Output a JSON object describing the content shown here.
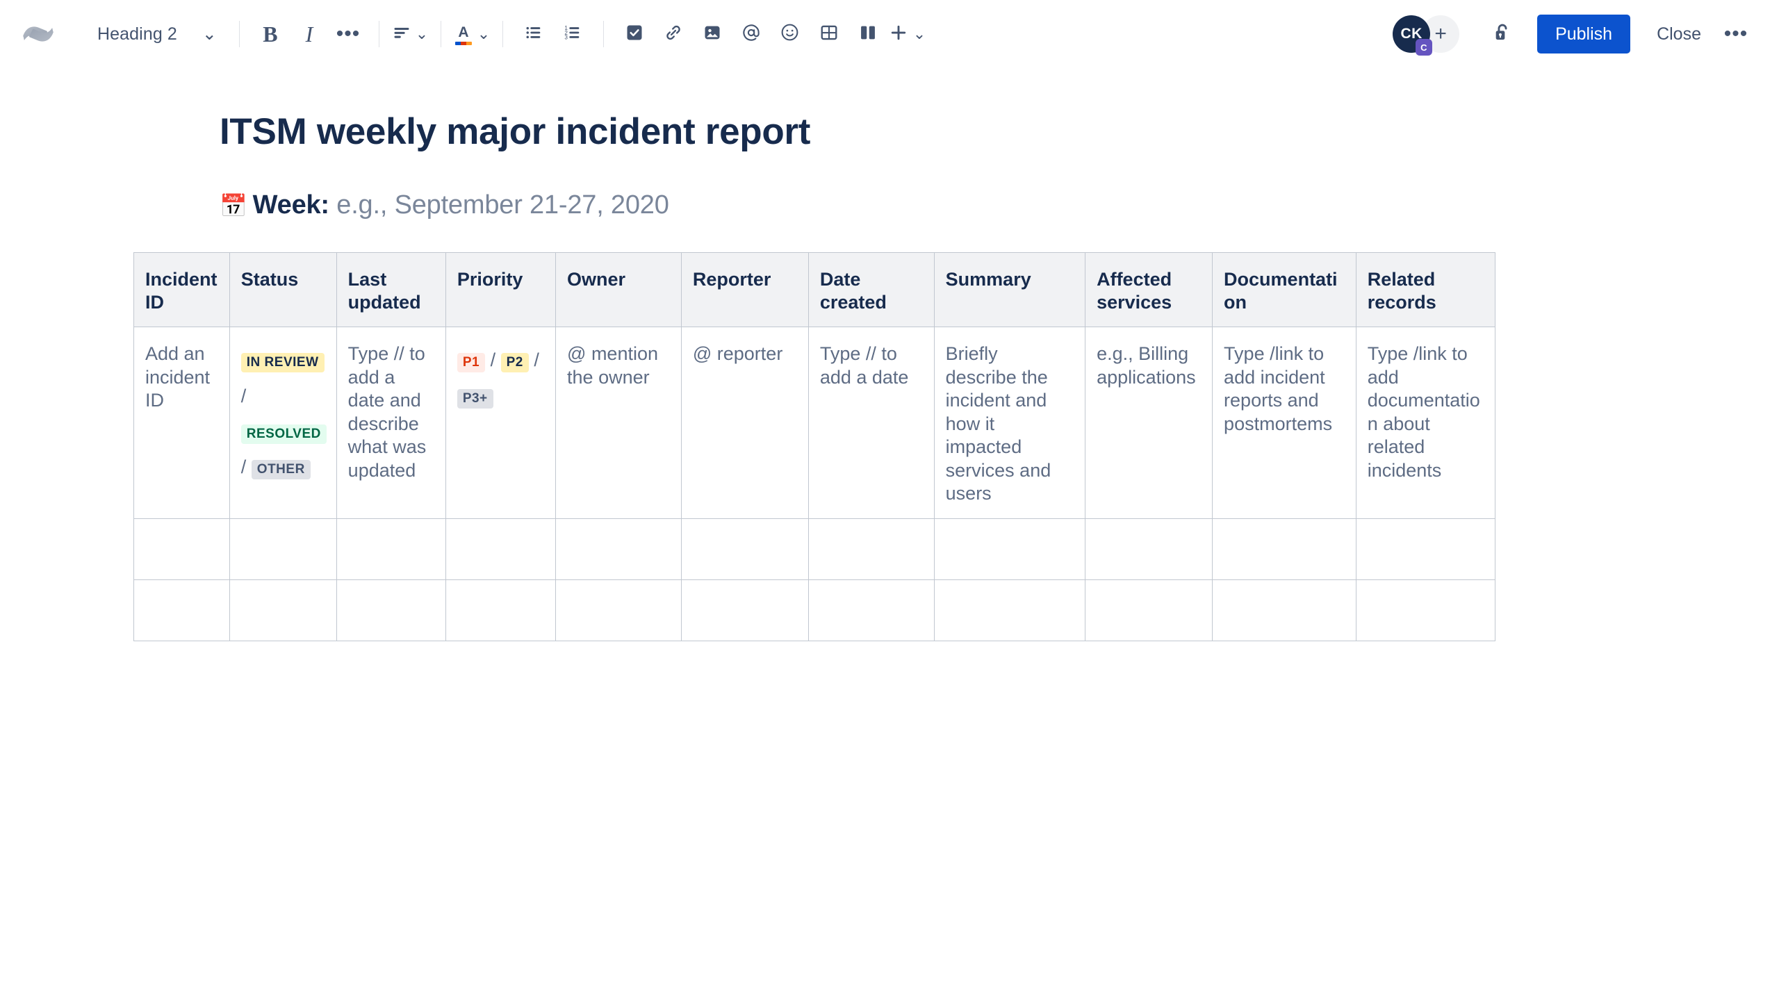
{
  "toolbar": {
    "logo_name": "confluence-logo",
    "style_select": {
      "label": "Heading 2",
      "chevron": "⌄"
    },
    "bold_label": "B",
    "italic_label": "I",
    "more_formatting_label": "•••",
    "align_label": "align-left",
    "text_color_label": "A",
    "bullet_list_label": "bullet-list",
    "numbered_list_label": "numbered-list",
    "task_label": "task-checkbox",
    "link_label": "link",
    "image_label": "image",
    "mention_label": "@",
    "emoji_label": "emoji",
    "table_label": "table",
    "layout_label": "layout-columns",
    "insert_label": "+",
    "insert_chevron": "⌄",
    "avatar_initials": "CK",
    "avatar_badge": "C",
    "add_people_label": "+",
    "restrictions_label": "unlock",
    "publish_label": "Publish",
    "close_label": "Close",
    "more_label": "•••"
  },
  "document": {
    "title": "ITSM weekly major incident report",
    "week_icon": "📅",
    "week_label": "Week:",
    "week_placeholder": "e.g., September 21-27, 2020"
  },
  "table": {
    "headers": [
      "Incident ID",
      "Status",
      "Last updated",
      "Priority",
      "Owner",
      "Reporter",
      "Date created",
      "Summary",
      "Affected services",
      "Documentation",
      "Related records"
    ],
    "row": {
      "incident_id": "Add an incident ID",
      "status": {
        "badges": [
          "IN REVIEW",
          "RESOLVED",
          "OTHER"
        ],
        "separator": "/"
      },
      "last_updated": "Type // to add a date and describe what was updated",
      "priority": {
        "badges": [
          "P1",
          "P2",
          "P3+"
        ],
        "separator": "/"
      },
      "owner": "@ mention the owner",
      "reporter": "@ reporter",
      "date_created": "Type // to add a date",
      "summary": "Briefly describe the incident and how it impacted services and users",
      "affected_services": "e.g., Billing applications",
      "documentation": "Type /link to add incident reports and postmortems",
      "related_records": "Type /link to add documentation about related incidents"
    },
    "empty_rows": 2
  },
  "colors": {
    "accent": "#0C53CE",
    "text": "#172B4D",
    "placeholder": "#5E6C84",
    "border": "#C1C7D0",
    "header_bg": "#F1F2F4",
    "badge_yellow": "#FFF0B3",
    "badge_green": "#E3FCEF",
    "badge_gray": "#DFE1E6",
    "badge_red": "#FFEBE6"
  }
}
